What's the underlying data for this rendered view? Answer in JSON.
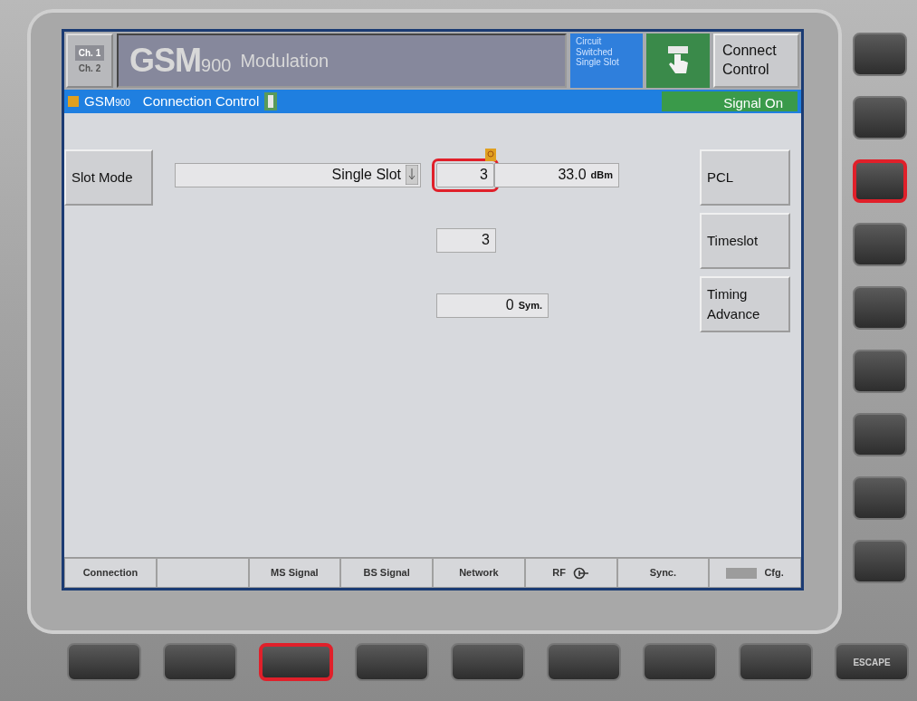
{
  "channel_tabs": [
    {
      "label": "Ch. 1",
      "selected": true
    },
    {
      "label": "Ch. 2",
      "selected": false
    }
  ],
  "header": {
    "system": "GSM",
    "band": "900",
    "title": "Modulation"
  },
  "status": {
    "lines": [
      "Circuit",
      "Switched",
      "Single Slot"
    ]
  },
  "connect_button": {
    "label": "Connect Control"
  },
  "menu_bar": {
    "system": "GSM",
    "band": "900",
    "title": "Connection Control",
    "signal_state": "Signal On"
  },
  "left_softkeys": [
    {
      "label": "Slot Mode"
    }
  ],
  "rows": [
    {
      "fields": [
        {
          "kind": "dropdown",
          "value": "Single Slot"
        },
        {
          "kind": "power",
          "value": "3",
          "reading": "33.0",
          "unit": "dBm",
          "highlighted": true
        }
      ]
    },
    {
      "fields": [
        {
          "kind": "number",
          "value": "3"
        }
      ]
    },
    {
      "fields": [
        {
          "kind": "number",
          "value": "0",
          "unit": "Sym."
        }
      ]
    }
  ],
  "right_softkeys": [
    {
      "label": "PCL"
    },
    {
      "label": "Timeslot"
    },
    {
      "label": "Timing Advance"
    }
  ],
  "bottom_tabs": [
    {
      "kind": "text",
      "label": "Connection"
    },
    {
      "kind": "blank"
    },
    {
      "kind": "text",
      "label": "MS Signal"
    },
    {
      "kind": "text",
      "label": "BS Signal"
    },
    {
      "kind": "text",
      "label": "Network"
    },
    {
      "kind": "icon",
      "label": "RF"
    },
    {
      "kind": "text",
      "label": "Sync."
    },
    {
      "kind": "badge",
      "label": "Cfg."
    }
  ],
  "side_keys": [
    {
      "highlighted": false
    },
    {
      "highlighted": false
    },
    {
      "highlighted": true
    },
    {
      "highlighted": false
    },
    {
      "highlighted": false
    },
    {
      "highlighted": false
    },
    {
      "highlighted": false
    },
    {
      "highlighted": false
    },
    {
      "highlighted": false
    }
  ],
  "bottom_keys": [
    {
      "highlighted": false
    },
    {
      "highlighted": false
    },
    {
      "highlighted": true
    },
    {
      "highlighted": false
    },
    {
      "highlighted": false
    },
    {
      "highlighted": false
    },
    {
      "highlighted": false
    },
    {
      "highlighted": false
    }
  ],
  "escape_key": {
    "label": "ESCAPE"
  }
}
